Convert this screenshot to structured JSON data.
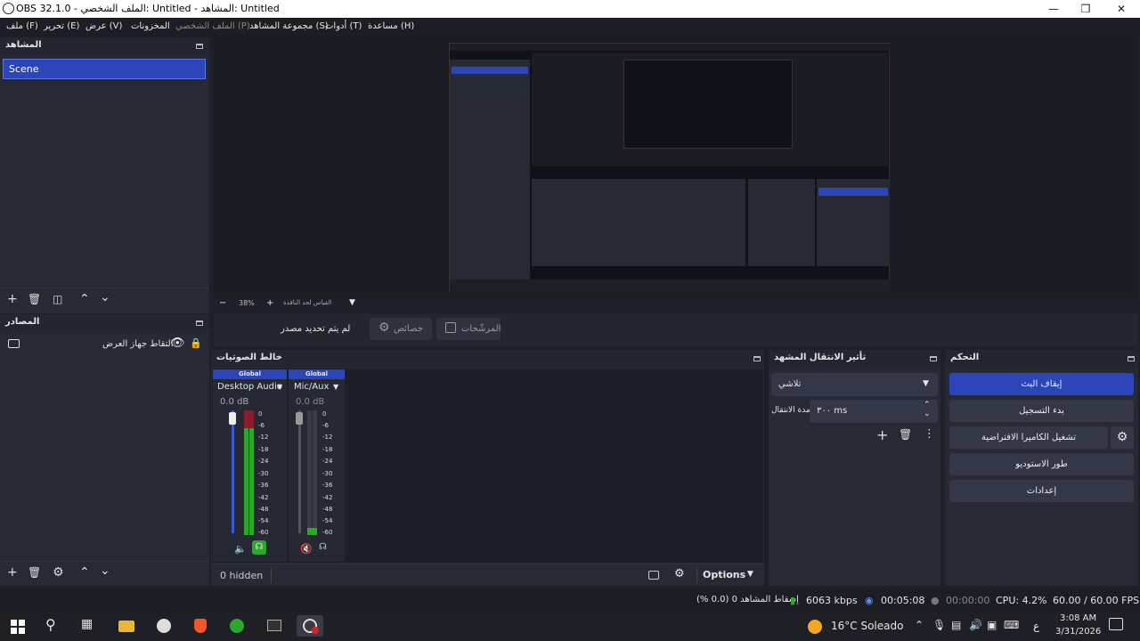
{
  "window": {
    "title": "OBS 32.1.0 - الملف الشخصي: Untitled - المشاهد: Untitled"
  },
  "menu": [
    "ملف (F)",
    "تحرير (E)",
    "عرض (V)",
    "المخزونات",
    "الملف الشخصي (P)",
    "مجموعة المشاهد (S)",
    "أدوات (T)",
    "مساعدة (H)"
  ],
  "scenes": {
    "title": "المشاهد",
    "items": [
      "Scene"
    ]
  },
  "sources": {
    "title": "المصادر",
    "items": [
      "التقاط جهاز العرض"
    ]
  },
  "preview": {
    "zoom": "38%",
    "hint": "القياس لحد النافذة"
  },
  "source_toolbar": {
    "no_source": "لم يتم تحديد مصدر",
    "properties": "خصائص",
    "filters": "المرشّحات"
  },
  "mixer": {
    "title": "خالط الصوتيات",
    "channels": [
      {
        "badge": "Global",
        "name": "Desktop Audio",
        "db": "0.0 dB"
      },
      {
        "badge": "Global",
        "name": "Mic/Aux",
        "db": "0.0 dB"
      }
    ],
    "scale": [
      "0",
      "-6",
      "-12",
      "-18",
      "-24",
      "-30",
      "-36",
      "-42",
      "-48",
      "-54",
      "-60"
    ],
    "hidden": "0 hidden",
    "options": "Options"
  },
  "transitions": {
    "title": "تأثير الانتقال المشهد",
    "type": "تلاشي",
    "duration_label": "مدة الانتقال",
    "duration_value": "٣٠٠ ms"
  },
  "controls": {
    "title": "التحكم",
    "buttons": [
      "إيقاف البث",
      "بدء التسجيل",
      "تشغيل الكاميرا الافتراضية",
      "طور الاستوديو",
      "إعدادات"
    ]
  },
  "status": {
    "dropped": "إسقاط المشاهد 0 (0.0 %)",
    "kbps": "6063 kbps",
    "stream_time": "00:05:08",
    "rec_time": "00:00:00",
    "cpu": "CPU: 4.2%",
    "fps": "60.00 / 60.00 FPS"
  },
  "taskbar": {
    "weather": "16°C Soleado",
    "lang": "ع",
    "time": "3:08 AM",
    "date": "3/31/2026"
  },
  "colors": {
    "accent": "#2c45b8",
    "dock": "#272935",
    "bg": "#1e1f28",
    "meter_green": "#2aa82a",
    "meter_red": "#8c1b2b"
  }
}
